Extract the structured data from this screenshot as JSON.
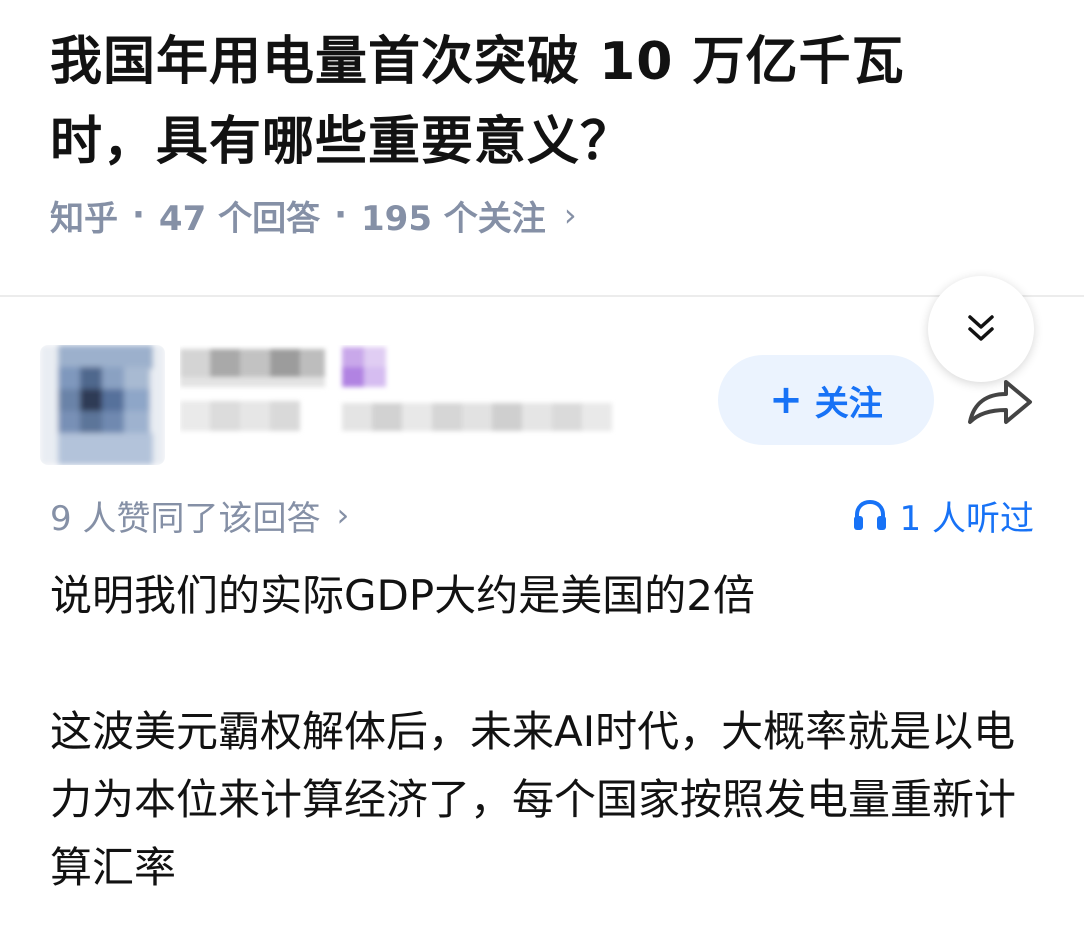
{
  "question": {
    "title": "我国年用电量首次突破 10 万亿千瓦时，具有哪些重要意义？",
    "source": "知乎",
    "separator": "·",
    "answers_count": "47 个回答",
    "followers_count": "195 个关注",
    "chevron": "›"
  },
  "answer": {
    "follow_button": {
      "plus": "+",
      "label": "关注"
    },
    "likes_text": "9 人赞同了该回答",
    "likes_chevron": "›",
    "listened_text": "1 人听过",
    "paragraphs": [
      "说明我们的实际GDP大约是美国的2倍",
      "这波美元霸权解体后，未来AI时代，大概率就是以电力为本位来计算经济了，每个国家按照发电量重新计算汇率"
    ]
  },
  "colors": {
    "brand_blue": "#1772f6",
    "follow_bg": "#ebf3fe",
    "meta_gray": "#8590a6",
    "text_dark": "#121212"
  },
  "icons": {
    "collapse": "double-chevron-down-icon",
    "share": "share-arrow-icon",
    "listen": "headphones-icon"
  }
}
